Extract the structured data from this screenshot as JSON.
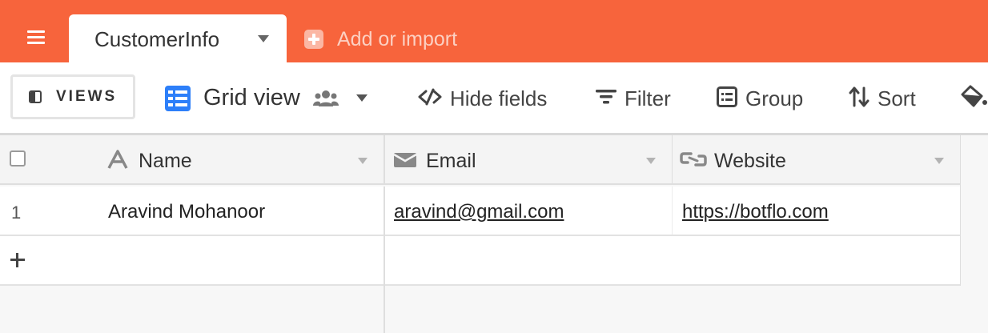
{
  "topbar": {
    "accent_color": "#f7643c",
    "menu_icon": "hamburger-icon",
    "active_table": "CustomerInfo",
    "add_import_label": "Add or import"
  },
  "toolbar": {
    "views_label": "VIEWS",
    "view_name": "Grid view",
    "view_icon": "grid-icon",
    "shared_icon": "people-icon",
    "hide_fields_label": "Hide fields",
    "filter_label": "Filter",
    "group_label": "Group",
    "sort_label": "Sort",
    "color_icon": "paint-bucket-icon"
  },
  "grid": {
    "columns": [
      {
        "name": "Name",
        "icon": "text-field-icon"
      },
      {
        "name": "Email",
        "icon": "email-icon"
      },
      {
        "name": "Website",
        "icon": "link-icon"
      }
    ],
    "rows": [
      {
        "number": "1",
        "name": "Aravind Mohanoor",
        "email": "aravind@gmail.com",
        "website": "https://botflo.com"
      }
    ],
    "add_row_symbol": "+"
  }
}
